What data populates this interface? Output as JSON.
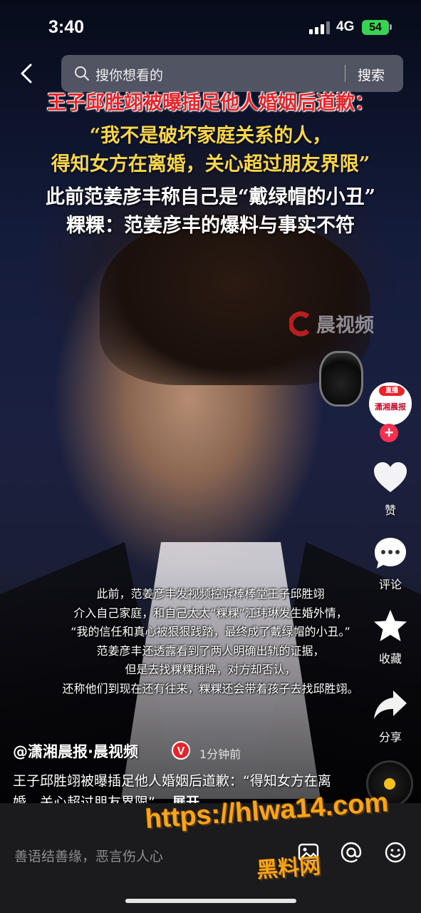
{
  "status_bar": {
    "time": "3:40",
    "network": "4G",
    "battery": "54"
  },
  "search": {
    "placeholder": "搜你想看的",
    "button": "搜索"
  },
  "headline": {
    "line1": "王子邱胜翊被曝插足他人婚姻后道歉：",
    "line2": "“我不是破坏家庭关系的人，",
    "line3": "得知女方在离婚，关心超过朋友界限”",
    "line4": "此前范姜彦丰称自己是“戴绿帽的小丑”",
    "line5": "粿粿：范姜彦丰的爆料与事实不符"
  },
  "watermark": {
    "brand": "晨视频"
  },
  "subtitles": [
    "此前，范姜彦丰发视频控诉棒棒堂王子邱胜翊",
    "介入自己家庭，和自己太太“粿粿”江玮琳发生婚外情，",
    "“我的信任和真心被狠狠践踏，最终成了戴绿帽的小丑。”",
    "范姜彦丰还透露看到了两人明确出轨的证据，",
    "但是去找粿粿摊牌，对方却否认，",
    "还称他们到现在还有往来，粿粿还会带着孩子去找邱胜翊。"
  ],
  "rail": {
    "avatar_live": "直播",
    "avatar_name": "潇湘晨报",
    "follow": "+",
    "like_label": "赞",
    "comment_label": "评论",
    "favorite_label": "收藏",
    "share_label": "分享"
  },
  "post": {
    "author": "@潇湘晨报·晨视频",
    "verified": "V",
    "time_ago": "1分钟前",
    "caption": "王子邱胜翊被曝插足他人婚姻后道歉：“得知女方在离婚，关心超过朋友界限”...",
    "expand": "展开"
  },
  "comment_bar": {
    "placeholder": "善语结善缘，恶言伤人心"
  },
  "promo": {
    "url": "https://hlwa14.com",
    "name": "黑料网"
  },
  "colors": {
    "accent_red": "#e8242b",
    "headline_yellow": "#f9d64a",
    "battery_green": "#39d353",
    "promo_orange": "#f6a51d"
  }
}
